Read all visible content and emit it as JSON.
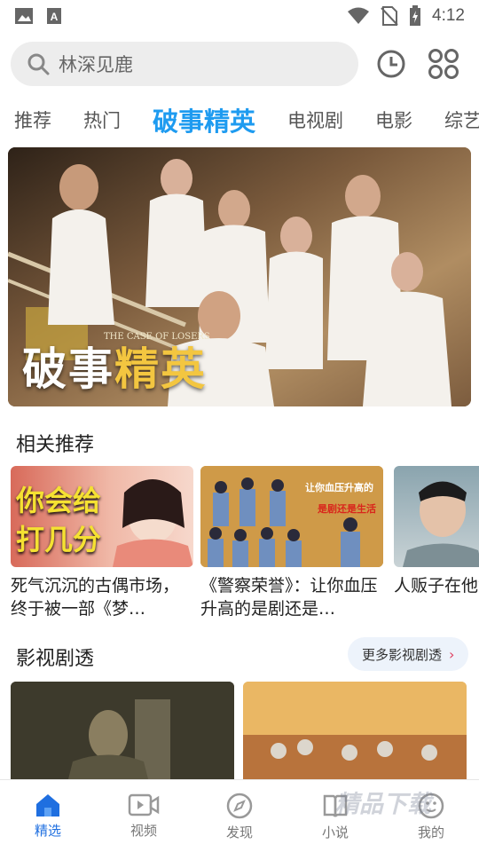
{
  "status_bar": {
    "time": "4:12",
    "icons": [
      "image-icon",
      "font-download-icon",
      "wifi-icon",
      "no-sim-icon",
      "battery-charging-icon"
    ]
  },
  "search": {
    "query": "林深见鹿",
    "icons": [
      "search-icon",
      "history-clock-icon",
      "grid-apps-icon"
    ]
  },
  "tabs": [
    {
      "label": "推荐",
      "active": false
    },
    {
      "label": "热门",
      "active": false
    },
    {
      "label": "破事精英",
      "active": true
    },
    {
      "label": "电视剧",
      "active": false
    },
    {
      "label": "电影",
      "active": false
    },
    {
      "label": "综艺",
      "active": false
    }
  ],
  "banner": {
    "title_part1": "破事",
    "title_part2": "精英",
    "subtitle": "THE CASE OF LOSERS"
  },
  "recommend": {
    "title": "相关推荐",
    "items": [
      {
        "thumb_text1": "你会给",
        "thumb_text2": "打几分",
        "desc": "死气沉沉的古偶市场，终于被一部《梦…"
      },
      {
        "thumb_text1": "让你血压升高的",
        "thumb_text2": "是剧还是生活",
        "desc": "《警察荣誉》：让你血压升高的是剧还是…"
      },
      {
        "desc": "人贩子在他警察发现,"
      }
    ]
  },
  "videos": {
    "title": "影视剧透",
    "more_label": "更多影视剧透"
  },
  "bottom_nav": [
    {
      "label": "精选",
      "icon": "home-icon",
      "active": true
    },
    {
      "label": "视频",
      "icon": "video-icon",
      "active": false
    },
    {
      "label": "发现",
      "icon": "compass-icon",
      "active": false
    },
    {
      "label": "小说",
      "icon": "book-icon",
      "active": false
    },
    {
      "label": "我的",
      "icon": "profile-icon",
      "active": false
    }
  ],
  "watermark": "精品下载",
  "colors": {
    "accent": "#1e9bf0",
    "nav_active": "#1f6fe0",
    "banner_gold": "#f3c640",
    "more_chevron": "#e04060"
  }
}
